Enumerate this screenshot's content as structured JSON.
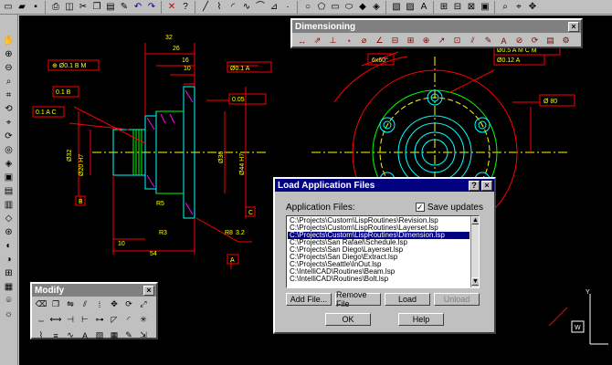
{
  "top_toolbar": {
    "icons": [
      "new-icon",
      "open-icon",
      "save-icon",
      "print-icon",
      "preview-icon",
      "cut-icon",
      "copy-icon",
      "paste-icon",
      "match-icon",
      "undo-icon",
      "redo-icon",
      "cancel-icon",
      "help-icon",
      "snap-icon",
      "osnap-icon",
      "grid-icon",
      "ortho-icon",
      "polar-icon",
      "track-icon",
      "ucs-icon",
      "layer-icon",
      "color-icon",
      "ltype-icon",
      "lweight-icon",
      "props-icon",
      "zoom-icon",
      "pan-icon",
      "window-icon",
      "close-icon"
    ]
  },
  "dimensioning_toolbar": {
    "title": "Dimensioning",
    "close": "×"
  },
  "modify_toolbar": {
    "title": "Modify",
    "close": "×"
  },
  "dialog": {
    "title": "Load Application Files",
    "help_glyph": "?",
    "close_glyph": "×",
    "list_label": "Application Files:",
    "save_updates_label": "Save updates",
    "save_updates_checked": "✓",
    "files": [
      "C:\\Projects\\Custom\\LispRoutines\\Revision.lsp",
      "C:\\Projects\\Custom\\LispRoutines\\Layerset.lsp",
      "C:\\Projects\\Custom\\LispRoutines\\Dimension.lsp",
      "C:\\Projects\\San Rafael\\Schedule.lsp",
      "C:\\Projects\\San Diego\\Layerset.lsp",
      "C:\\Projects\\San Diego\\Extract.lsp",
      "C:\\Projects\\Seattle\\InOut.lsp",
      "C:\\IntelliCAD\\Routines\\Beam.lsp",
      "C:\\IntelliCAD\\Routines\\Bolt.lsp"
    ],
    "selected_index": 2,
    "buttons": {
      "add": "Add File...",
      "remove": "Remove File",
      "load": "Load",
      "unload": "Unload",
      "ok": "OK",
      "help": "Help"
    }
  },
  "drawing_labels": {
    "dim_32": "32",
    "dim_26": "26",
    "dim_16": "16",
    "dim_10": "10",
    "dim_54": "54",
    "dim_10b": "10",
    "dim_r8": "R8",
    "dim_32b": "3.2",
    "dim_phi44": "Ø44 H7",
    "dim_phi36": "Ø36",
    "dim_phi20": "Ø20 H7",
    "dim_phi32": "Ø32",
    "dim_80": "Ø 80",
    "dim_6x60": "6x60°",
    "fcf1": "⊕ Ø0.1 B M",
    "fcf2": "Ø0.1 A",
    "fcf3": "Ø0.5 A M C M",
    "fcf4": "Ø0.12 A",
    "fcf5": "0.05",
    "fcf6": "0.1 A C",
    "fcf7": "0.1 B",
    "datum_a": "A",
    "datum_b": "B",
    "datum_c": "C",
    "r5": "R5",
    "r3": "R3",
    "ucs_w": "W",
    "ucs_y": "Y"
  },
  "colors": {
    "background": "#000000",
    "red": "#ff0000",
    "yellow": "#ffff00",
    "cyan": "#00ffff",
    "green": "#00ff00",
    "magenta": "#ff00ff",
    "white": "#ffffff",
    "blue_title": "#000080"
  }
}
